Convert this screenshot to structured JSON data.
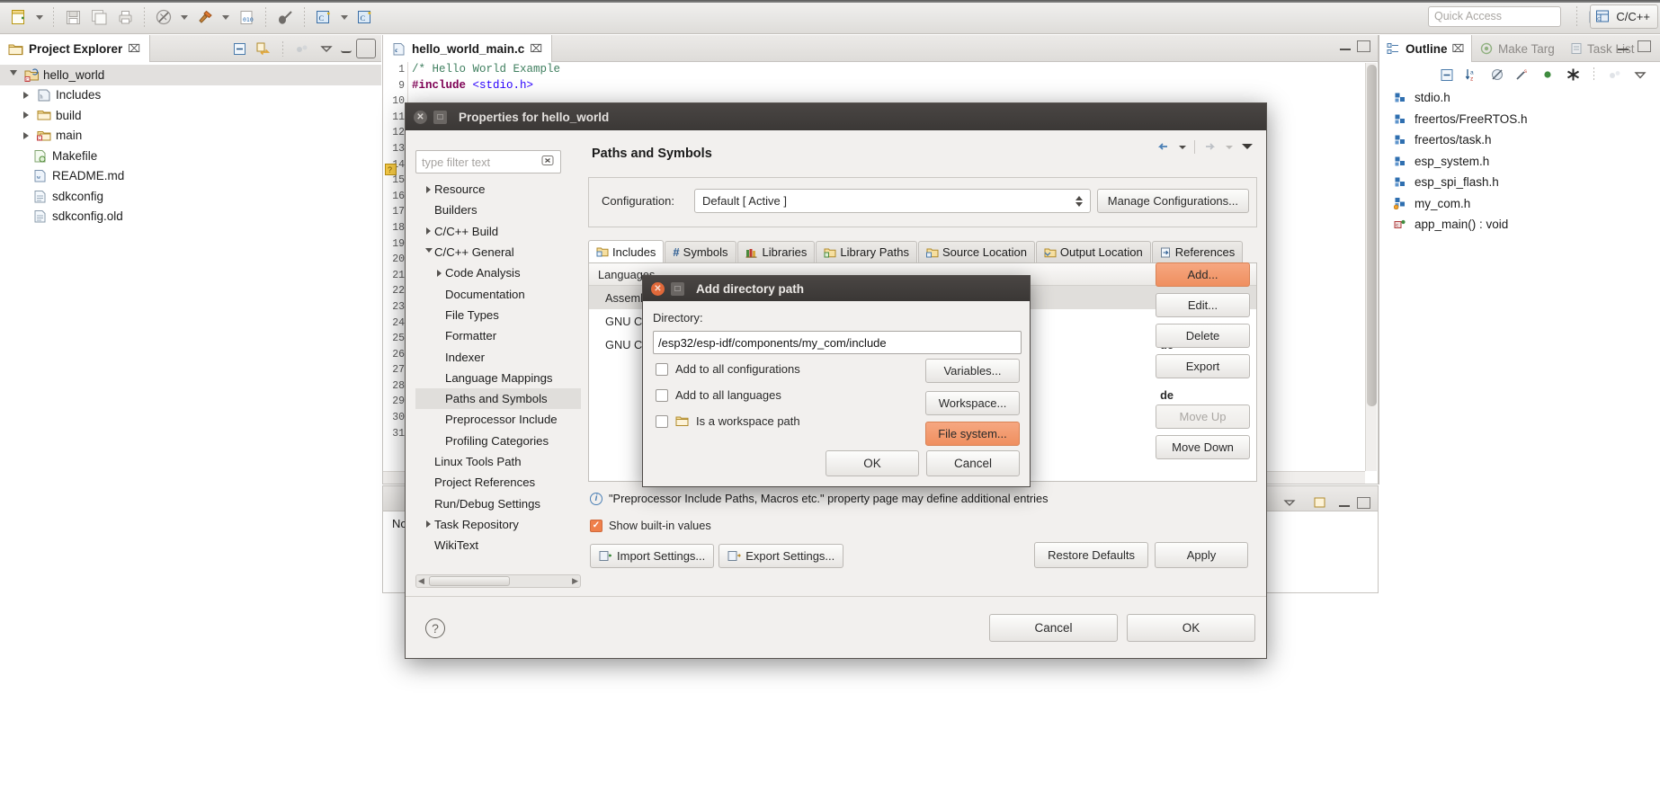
{
  "toolbar": {
    "quick_access_placeholder": "Quick Access",
    "perspective_label": "C/C++",
    "buttons": [
      {
        "name": "new-wizard",
        "label": "New"
      },
      {
        "name": "save",
        "label": "Save"
      },
      {
        "name": "save-all",
        "label": "Save All"
      },
      {
        "name": "print",
        "label": "Print"
      },
      {
        "name": "build-all",
        "label": "Build All"
      },
      {
        "name": "build",
        "label": "Build"
      },
      {
        "name": "binary",
        "label": "Binary"
      },
      {
        "name": "debug",
        "label": "Debug"
      },
      {
        "name": "new-c-project",
        "label": "New C/C++ Project"
      },
      {
        "name": "new-class",
        "label": "New Class"
      }
    ]
  },
  "project_explorer": {
    "tab_label": "Project Explorer",
    "tab_close": "⌧",
    "tree": [
      {
        "label": "hello_world",
        "icon": "c-project-icon",
        "depth": 0,
        "twisty": "open",
        "selected": true
      },
      {
        "label": "Includes",
        "icon": "includes-icon",
        "depth": 1,
        "twisty": "closed",
        "selected": false
      },
      {
        "label": "build",
        "icon": "folder-icon",
        "depth": 1,
        "twisty": "closed",
        "selected": false
      },
      {
        "label": "main",
        "icon": "source-folder-icon",
        "depth": 1,
        "twisty": "closed",
        "selected": false
      },
      {
        "label": "Makefile",
        "icon": "makefile-icon",
        "depth": 1,
        "twisty": "none",
        "selected": false
      },
      {
        "label": "README.md",
        "icon": "markdown-icon",
        "depth": 1,
        "twisty": "none",
        "selected": false
      },
      {
        "label": "sdkconfig",
        "icon": "file-icon",
        "depth": 1,
        "twisty": "none",
        "selected": false
      },
      {
        "label": "sdkconfig.old",
        "icon": "file-icon",
        "depth": 1,
        "twisty": "none",
        "selected": false
      }
    ]
  },
  "editor": {
    "tab_label": "hello_world_main.c",
    "tab_close": "⌧",
    "lines": [
      {
        "num": "1",
        "text": "/* Hello World Example",
        "style": "comment"
      },
      {
        "num": "9",
        "text": "#include <stdio.h>",
        "style": "include"
      },
      {
        "num": "10",
        "text": "",
        "style": "plain"
      },
      {
        "num": "11",
        "text": "",
        "style": "plain"
      },
      {
        "num": "12",
        "text": "",
        "style": "plain"
      },
      {
        "num": "13",
        "text": "",
        "style": "plain"
      },
      {
        "num": "14",
        "text": "",
        "style": "plain"
      },
      {
        "num": "15",
        "text": "",
        "style": "plain"
      },
      {
        "num": "16",
        "text": "",
        "style": "plain"
      },
      {
        "num": "17",
        "text": "",
        "style": "plain"
      },
      {
        "num": "18",
        "text": "",
        "style": "plain"
      },
      {
        "num": "19",
        "text": "",
        "style": "plain"
      },
      {
        "num": "20",
        "text": "",
        "style": "plain"
      },
      {
        "num": "21",
        "text": "",
        "style": "plain"
      },
      {
        "num": "22",
        "text": "",
        "style": "plain"
      },
      {
        "num": "23",
        "text": "",
        "style": "plain"
      },
      {
        "num": "24",
        "text": "",
        "style": "plain"
      },
      {
        "num": "25",
        "text": "",
        "style": "plain"
      },
      {
        "num": "26",
        "text": "",
        "style": "plain"
      },
      {
        "num": "27",
        "text": "",
        "style": "plain"
      },
      {
        "num": "28",
        "text": "",
        "style": "plain"
      },
      {
        "num": "29",
        "text": "",
        "style": "plain"
      },
      {
        "num": "30",
        "text": "",
        "style": "plain"
      },
      {
        "num": "31",
        "text": "",
        "style": "plain"
      }
    ],
    "include_keyword": "#include",
    "include_header": "<stdio.h>"
  },
  "bottom_view": {
    "text": "No"
  },
  "outline": {
    "tabs": [
      {
        "label": "Outline",
        "active": true,
        "icon": "outline-icon"
      },
      {
        "label": "Make Targ",
        "active": false,
        "icon": "make-target-icon"
      },
      {
        "label": "Task List",
        "active": false,
        "icon": "task-list-icon"
      }
    ],
    "tab_close": "⌧",
    "items": [
      {
        "label": "stdio.h",
        "icon": "include-icon"
      },
      {
        "label": "freertos/FreeRTOS.h",
        "icon": "include-icon"
      },
      {
        "label": "freertos/task.h",
        "icon": "include-icon"
      },
      {
        "label": "esp_system.h",
        "icon": "include-icon"
      },
      {
        "label": "esp_spi_flash.h",
        "icon": "include-icon"
      },
      {
        "label": "my_com.h",
        "icon": "include-warning-icon"
      },
      {
        "label": "app_main() : void",
        "icon": "function-icon"
      }
    ]
  },
  "properties_dialog": {
    "title": "Properties for hello_world",
    "filter_placeholder": "type filter text",
    "filter_clear_icon": "clear-icon",
    "tree": [
      {
        "label": "Resource",
        "depth": 0,
        "twisty": "closed",
        "selected": false
      },
      {
        "label": "Builders",
        "depth": 0,
        "twisty": "none",
        "selected": false
      },
      {
        "label": "C/C++ Build",
        "depth": 0,
        "twisty": "closed",
        "selected": false
      },
      {
        "label": "C/C++ General",
        "depth": 0,
        "twisty": "open",
        "selected": false
      },
      {
        "label": "Code Analysis",
        "depth": 1,
        "twisty": "closed",
        "selected": false
      },
      {
        "label": "Documentation",
        "depth": 1,
        "twisty": "none",
        "selected": false
      },
      {
        "label": "File Types",
        "depth": 1,
        "twisty": "none",
        "selected": false
      },
      {
        "label": "Formatter",
        "depth": 1,
        "twisty": "none",
        "selected": false
      },
      {
        "label": "Indexer",
        "depth": 1,
        "twisty": "none",
        "selected": false
      },
      {
        "label": "Language Mappings",
        "depth": 1,
        "twisty": "none",
        "selected": false
      },
      {
        "label": "Paths and Symbols",
        "depth": 1,
        "twisty": "none",
        "selected": true
      },
      {
        "label": "Preprocessor Include",
        "depth": 1,
        "twisty": "none",
        "selected": false
      },
      {
        "label": "Profiling Categories",
        "depth": 1,
        "twisty": "none",
        "selected": false
      },
      {
        "label": "Linux Tools Path",
        "depth": 0,
        "twisty": "none",
        "selected": false
      },
      {
        "label": "Project References",
        "depth": 0,
        "twisty": "none",
        "selected": false
      },
      {
        "label": "Run/Debug Settings",
        "depth": 0,
        "twisty": "none",
        "selected": false
      },
      {
        "label": "Task Repository",
        "depth": 0,
        "twisty": "closed",
        "selected": false
      },
      {
        "label": "WikiText",
        "depth": 0,
        "twisty": "none",
        "selected": false
      }
    ],
    "page_title": "Paths and Symbols",
    "configuration_label": "Configuration:",
    "configuration_value": "Default  [ Active ]",
    "manage_configurations_label": "Manage Configurations...",
    "tabs": [
      {
        "label": "Includes",
        "icon": "includes-tab-icon",
        "active": true
      },
      {
        "label": "Symbols",
        "icon": "hash-icon",
        "active": false
      },
      {
        "label": "Libraries",
        "icon": "libraries-icon",
        "active": false
      },
      {
        "label": "Library Paths",
        "icon": "library-paths-icon",
        "active": false
      },
      {
        "label": "Source Location",
        "icon": "source-location-icon",
        "active": false
      },
      {
        "label": "Output Location",
        "icon": "output-location-icon",
        "active": false
      },
      {
        "label": "References",
        "icon": "references-icon",
        "active": false
      }
    ],
    "table": {
      "header": "Languages",
      "rows": [
        {
          "label": "Assembly",
          "selected": true
        },
        {
          "label": "GNU C",
          "selected": false
        },
        {
          "label": "GNU C++",
          "selected": false
        }
      ],
      "right_partial_labels": [
        "de",
        "de",
        "de"
      ]
    },
    "side_buttons": [
      {
        "label": "Add...",
        "style": "accent",
        "name": "add-button"
      },
      {
        "label": "Edit...",
        "style": "normal",
        "name": "edit-button"
      },
      {
        "label": "Delete",
        "style": "normal",
        "name": "delete-button"
      },
      {
        "label": "Export",
        "style": "normal",
        "name": "export-button"
      },
      {
        "label": "Move Up",
        "style": "disabled",
        "name": "move-up-button"
      },
      {
        "label": "Move Down",
        "style": "normal",
        "name": "move-down-button"
      }
    ],
    "info_text": "\"Preprocessor Include Paths, Macros etc.\" property page may define additional entries",
    "show_builtin_label": "Show built-in values",
    "show_builtin_checked": true,
    "import_settings_label": "Import Settings...",
    "export_settings_label": "Export Settings...",
    "restore_defaults_label": "Restore Defaults",
    "apply_label": "Apply",
    "help_icon": "question-mark-icon",
    "cancel_label": "Cancel",
    "ok_label": "OK"
  },
  "add_directory_dialog": {
    "title": "Add directory path",
    "directory_label": "Directory:",
    "directory_value": "/esp32/esp-idf/components/my_com/include",
    "checkboxes": [
      {
        "label": "Add to all configurations",
        "checked": false,
        "icon": "none"
      },
      {
        "label": "Add to all languages",
        "checked": false,
        "icon": "none"
      },
      {
        "label": "Is a workspace path",
        "checked": false,
        "icon": "folder-icon"
      }
    ],
    "variables_label": "Variables...",
    "workspace_label": "Workspace...",
    "filesystem_label": "File system...",
    "ok_label": "OK",
    "cancel_label": "Cancel"
  },
  "colors": {
    "accent_orange": "#ef8f5f",
    "titlebar_dark": "#3e3b39",
    "selection_gray": "#e0dedb",
    "comment_green": "#3f7f5f",
    "keyword_purple": "#7f0055",
    "string_blue": "#2a00ff"
  }
}
